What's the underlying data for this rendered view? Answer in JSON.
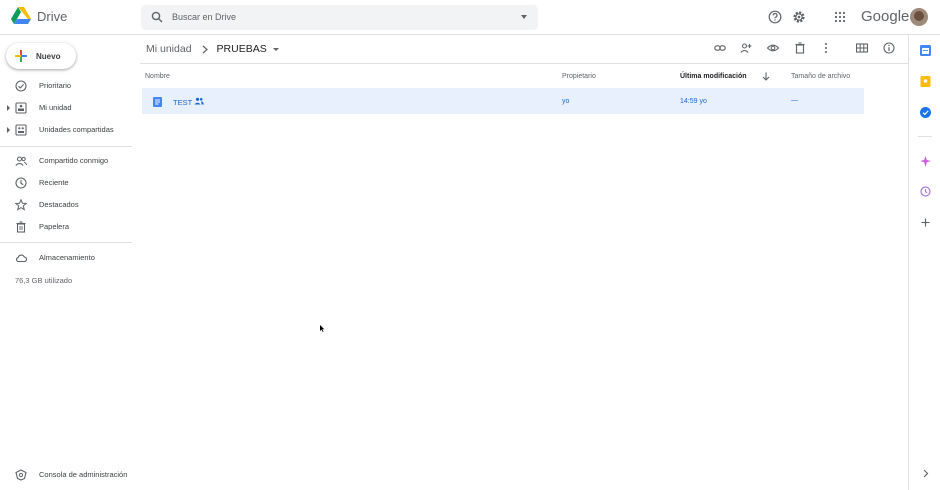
{
  "app": {
    "name": "Drive",
    "google_label": "Google"
  },
  "search": {
    "placeholder": "Buscar en Drive"
  },
  "header_icons": [
    "help-icon",
    "settings-icon",
    "apps-grid-icon"
  ],
  "sidebar": {
    "new_label": "Nuevo",
    "items": [
      {
        "label": "Prioritario",
        "icon": "priority-check-icon"
      },
      {
        "label": "Mi unidad",
        "icon": "my-drive-icon"
      },
      {
        "label": "Unidades compartidas",
        "icon": "shared-drives-icon"
      },
      {
        "label": "Compartido conmigo",
        "icon": "shared-with-me-icon"
      },
      {
        "label": "Reciente",
        "icon": "clock-icon"
      },
      {
        "label": "Destacados",
        "icon": "star-icon"
      },
      {
        "label": "Papelera",
        "icon": "trash-icon"
      },
      {
        "label": "Almacenamiento",
        "icon": "cloud-icon"
      }
    ],
    "storage_text": "76,3 GB utilizado",
    "admin_console_label": "Consola de administración"
  },
  "breadcrumb": {
    "parent": "Mi unidad",
    "current": "PRUEBAS"
  },
  "toolbar_icons": [
    "link-icon",
    "add-person-icon",
    "preview-eye-icon",
    "delete-icon",
    "more-vert-icon",
    "grid-view-icon",
    "info-icon"
  ],
  "table": {
    "headers": {
      "name": "Nombre",
      "owner": "Propietario",
      "modified": "Última modificación",
      "size": "Tamaño de archivo"
    },
    "rows": [
      {
        "name": "TEST",
        "owner": "yo",
        "modified": "14:59 yo",
        "size": "—",
        "shared": true,
        "type": "google-doc"
      }
    ]
  },
  "colors": {
    "accent_blue": "#1967d2",
    "selected_row": "#e8f0fe",
    "search_bg": "#f1f3f4"
  }
}
